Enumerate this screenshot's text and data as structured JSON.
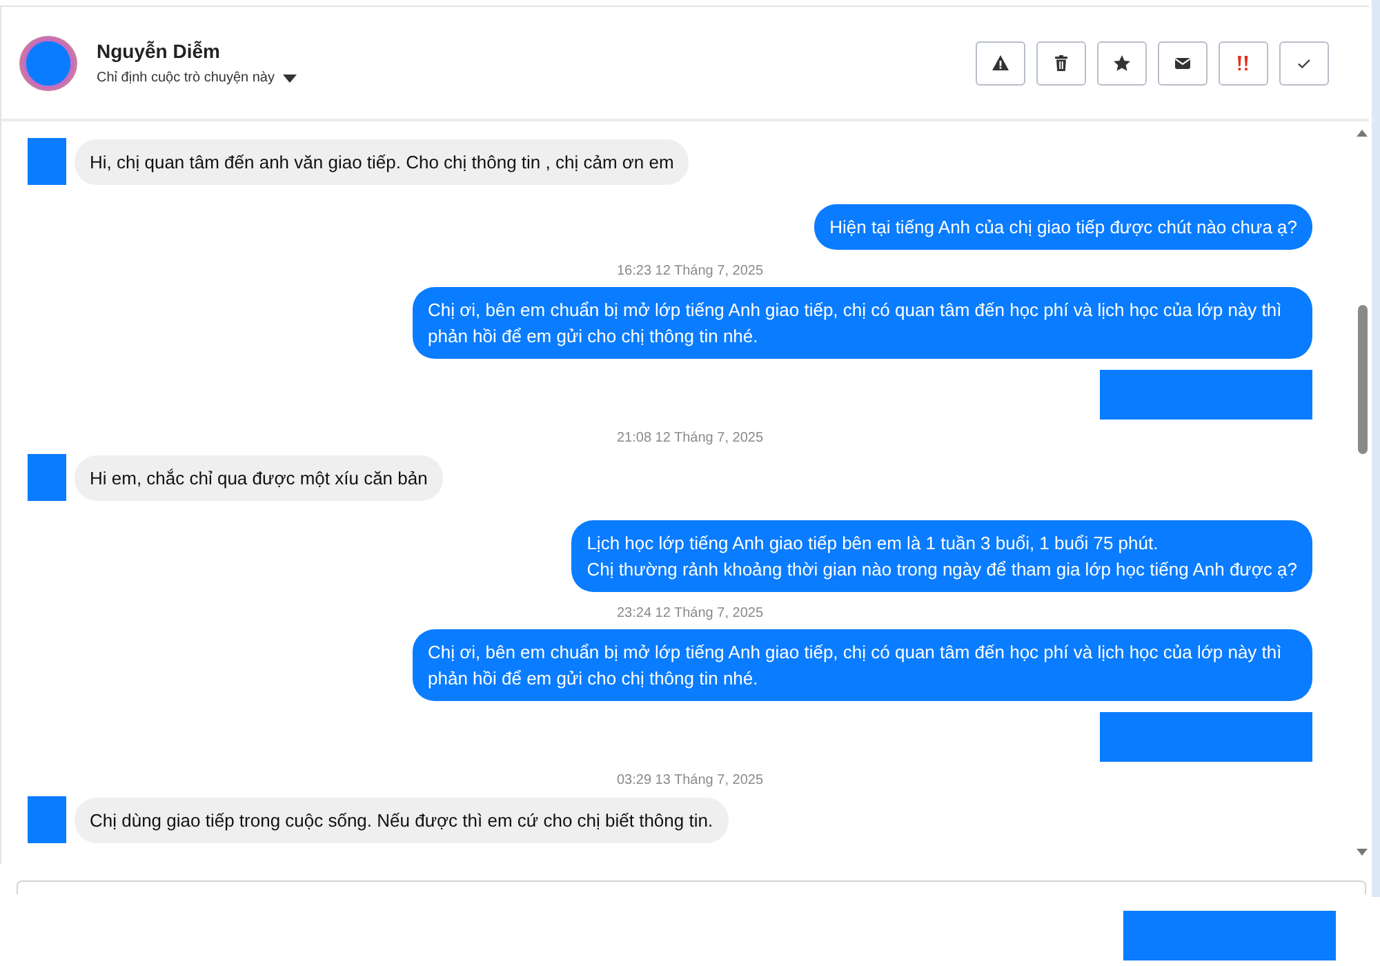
{
  "header": {
    "name": "Nguyễn Diễm",
    "assign_label": "Chỉ định cuộc trò chuyện này",
    "actions": [
      {
        "kind": "warning"
      },
      {
        "kind": "trash"
      },
      {
        "kind": "star"
      },
      {
        "kind": "mail"
      },
      {
        "kind": "urgent"
      },
      {
        "kind": "check"
      }
    ]
  },
  "messages": [
    {
      "kind": "incoming",
      "text": "Hi, chị quan tâm đến anh văn giao tiếp. Cho chị thông tin , chị cảm ơn em"
    },
    {
      "kind": "outgoing",
      "text": "Hiện tại tiếng Anh của chị giao tiếp được chút nào chưa ạ?"
    },
    {
      "kind": "timestamp",
      "text": "16:23 12 Tháng 7, 2025"
    },
    {
      "kind": "outgoing",
      "text": "Chị ơi, bên em chuẩn bị mở lớp tiếng Anh giao tiếp, chị có quan tâm đến học phí và lịch học của lớp này thì phản hồi để em gửi cho chị thông tin nhé."
    },
    {
      "kind": "redacted"
    },
    {
      "kind": "timestamp",
      "text": "21:08 12 Tháng 7, 2025"
    },
    {
      "kind": "incoming",
      "text": "Hi em, chắc chỉ qua được một xíu căn bản"
    },
    {
      "kind": "outgoing",
      "text": "Lịch học lớp tiếng Anh giao tiếp bên em là 1 tuần 3 buổi, 1 buổi 75 phút.\nChị thường rảnh khoảng thời gian nào trong ngày để tham gia lớp học tiếng Anh được ạ?"
    },
    {
      "kind": "timestamp",
      "text": "23:24 12 Tháng 7, 2025"
    },
    {
      "kind": "outgoing",
      "text": "Chị ơi, bên em chuẩn bị mở lớp tiếng Anh giao tiếp, chị có quan tâm đến học phí và lịch học của lớp này thì phản hồi để em gửi cho chị thông tin nhé."
    },
    {
      "kind": "redacted"
    },
    {
      "kind": "timestamp",
      "text": "03:29 13 Tháng 7, 2025"
    },
    {
      "kind": "incoming",
      "text": "Chị dùng giao tiếp trong cuộc sống. Nếu được thì em cứ cho chị biết thông tin."
    }
  ]
}
